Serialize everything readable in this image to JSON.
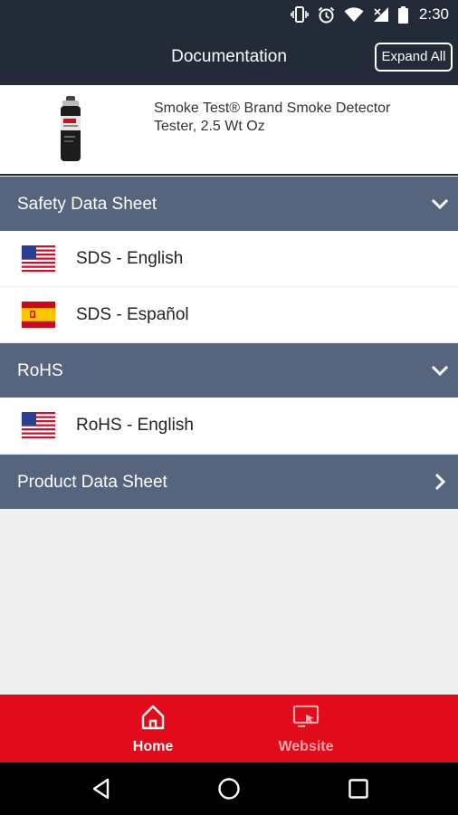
{
  "status_bar": {
    "time": "2:30",
    "icons": [
      "vibrate-icon",
      "alarm-icon",
      "wifi-icon",
      "signal-icon",
      "battery-icon"
    ]
  },
  "app_bar": {
    "title": "Documentation",
    "expand_all_label": "Expand All"
  },
  "product": {
    "name": "Smoke Test® Brand Smoke Detector Tester, 2.5 Wt Oz"
  },
  "sections": [
    {
      "label": "Safety Data Sheet",
      "expanded": true,
      "items": [
        {
          "label": "SDS - English",
          "flag": "us-flag-icon"
        },
        {
          "label": "SDS - Español",
          "flag": "es-flag-icon"
        }
      ]
    },
    {
      "label": "RoHS",
      "expanded": true,
      "items": [
        {
          "label": "RoHS - English",
          "flag": "us-flag-icon"
        }
      ]
    },
    {
      "label": "Product Data Sheet",
      "expanded": false,
      "items": []
    }
  ],
  "bottom_nav": {
    "items": [
      {
        "label": "Home",
        "icon": "home-icon",
        "active": true
      },
      {
        "label": "Website",
        "icon": "website-icon",
        "active": false
      }
    ]
  },
  "colors": {
    "app_bar": "#232b38",
    "section_header": "#56647d",
    "bottom_nav": "#e20b1b",
    "inactive_nav_label": "#f4a6ab"
  }
}
